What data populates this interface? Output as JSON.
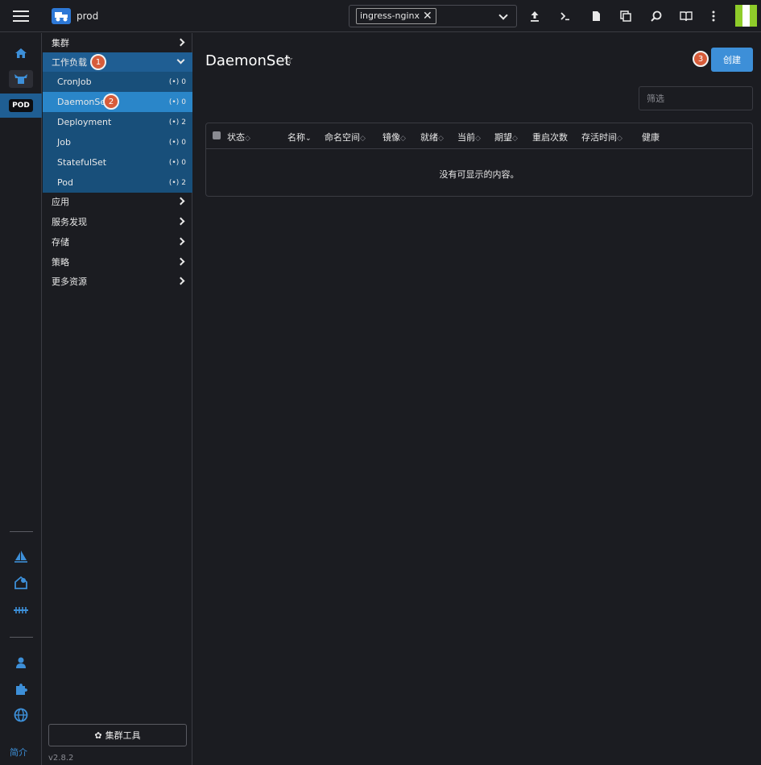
{
  "header": {
    "cluster_name": "prod",
    "namespace_chip": "ingress-nginx"
  },
  "rail": {
    "pod_label": "POD",
    "about_label": "简介"
  },
  "sidenav": {
    "groups": [
      {
        "label": "集群"
      },
      {
        "label": "工作负载"
      },
      {
        "label": "应用"
      },
      {
        "label": "服务发现"
      },
      {
        "label": "存储"
      },
      {
        "label": "策略"
      },
      {
        "label": "更多资源"
      }
    ],
    "workload_items": [
      {
        "label": "CronJob",
        "count": "0"
      },
      {
        "label": "DaemonSet",
        "count": "0"
      },
      {
        "label": "Deployment",
        "count": "2"
      },
      {
        "label": "Job",
        "count": "0"
      },
      {
        "label": "StatefulSet",
        "count": "0"
      },
      {
        "label": "Pod",
        "count": "2"
      }
    ],
    "cluster_tools_label": "集群工具",
    "version": "v2.8.2"
  },
  "annotations": {
    "step1": "1",
    "step2": "2",
    "step3": "3"
  },
  "main": {
    "title": "DaemonSet",
    "create_label": "创建",
    "filter_placeholder": "筛选",
    "columns": [
      "状态",
      "名称",
      "命名空间",
      "镜像",
      "就绪",
      "当前",
      "期望",
      "重启次数",
      "存活时间",
      "健康"
    ],
    "empty_text": "没有可显示的内容。"
  },
  "colors": {
    "accent": "#3d8fd8",
    "nav_selected": "#2a86c9",
    "nav_group_open": "#1f5e93",
    "annotation_badge": "#d75c3a"
  }
}
